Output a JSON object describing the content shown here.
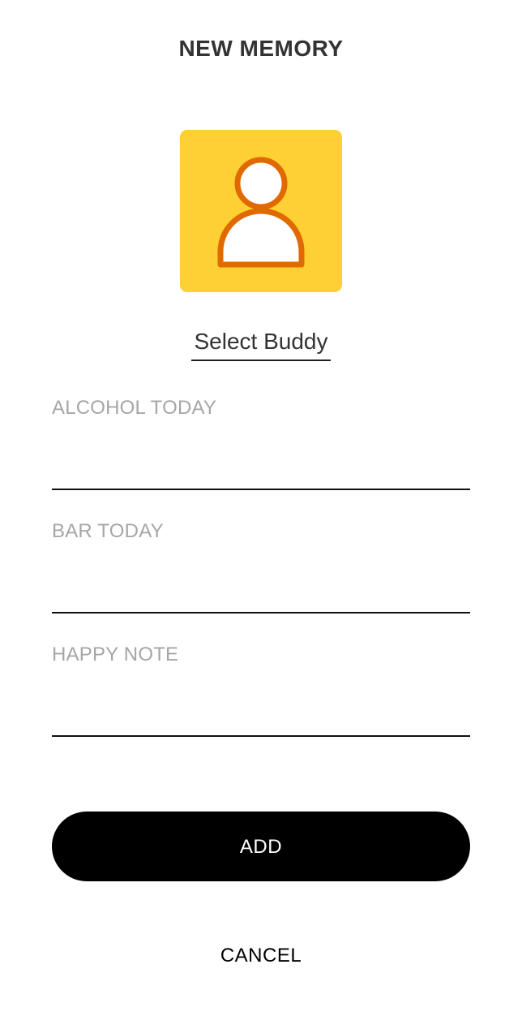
{
  "header": {
    "title": "NEW MEMORY"
  },
  "buddy": {
    "icon": "person-icon",
    "select_label": "Select Buddy",
    "colors": {
      "tile": "#ffd033",
      "outline": "#e06a00"
    }
  },
  "form": {
    "alcohol": {
      "label": "ALCOHOL TODAY",
      "value": ""
    },
    "bar": {
      "label": "BAR TODAY",
      "value": ""
    },
    "note": {
      "label": "HAPPY NOTE",
      "value": ""
    }
  },
  "actions": {
    "add_label": "ADD",
    "cancel_label": "CANCEL"
  }
}
